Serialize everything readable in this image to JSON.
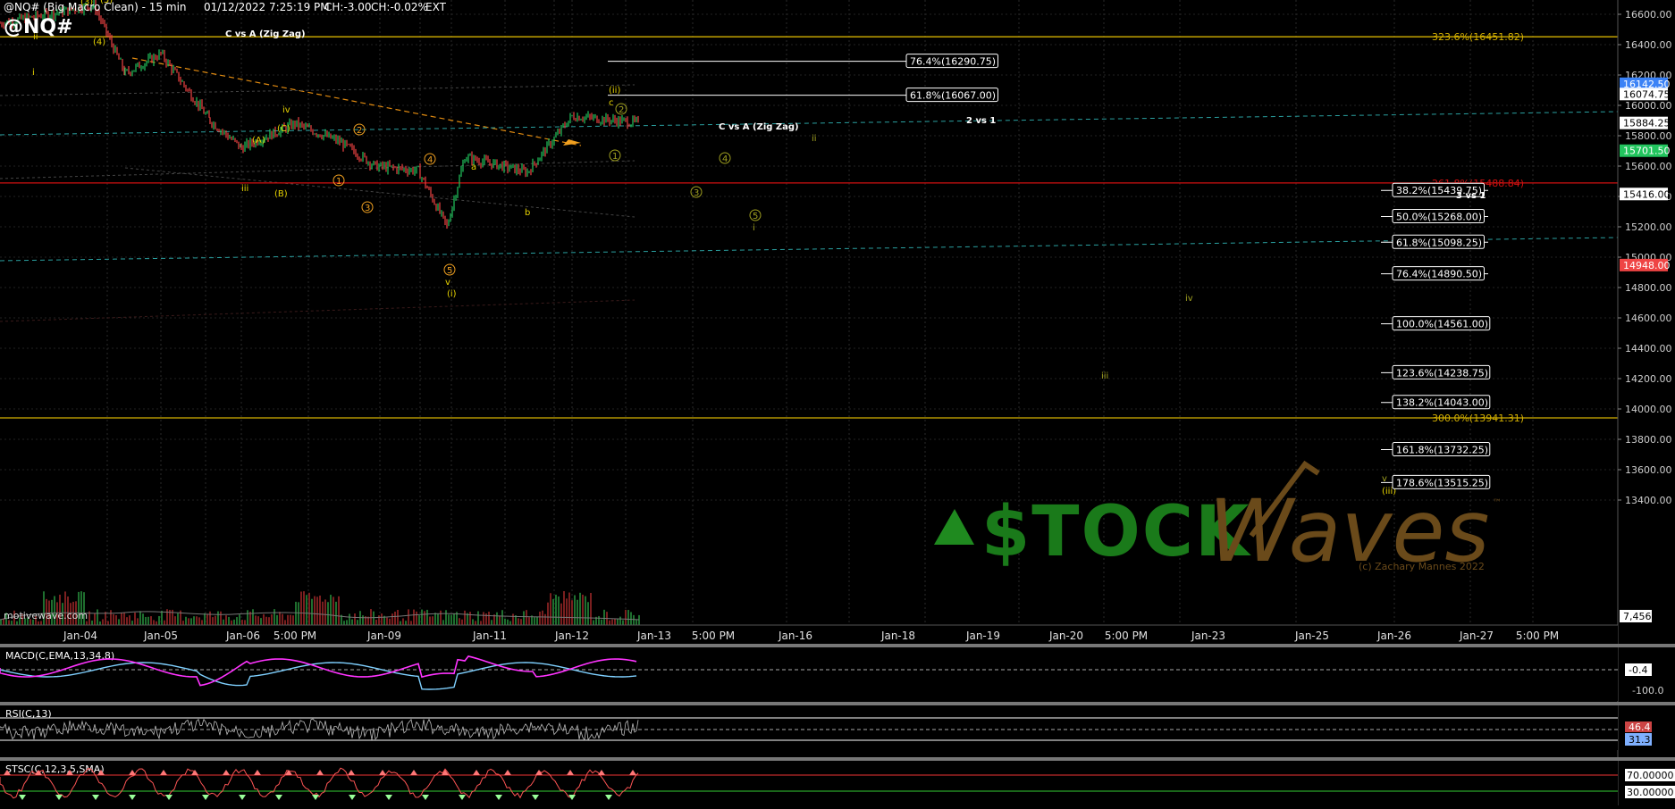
{
  "header": {
    "symbol": "@NQ# (Big Macro Clean) - 15 min",
    "datetime": "01/12/2022 7:25:19 PM",
    "change": "CH:-3.00",
    "change_pct": "CH:-0.02%",
    "session": "EXT",
    "ticker_big": "@NQ#"
  },
  "watermark": {
    "stock_text": "$TOCK",
    "waves_text": "Waves",
    "trademark": "™",
    "copyright": "(c) Zachary Mannes 2022",
    "site": "motivewave.com"
  },
  "colors": {
    "background": "#000000",
    "up_candle": "#22c55e",
    "down_candle": "#ef4444",
    "wave_yellow": "#e6d200",
    "wave_orange": "#f0a020",
    "wave_olive": "#a0a020",
    "fib_line": "#ffffff",
    "extension_red": "#d01010",
    "macd_line": "#ff33ff",
    "macd_signal": "#7fd0ff",
    "rsi_line": "#bbbbbb",
    "stoch_line": "#ff5555"
  },
  "chart_data": {
    "type": "line",
    "title": "@NQ# (Big Macro Clean) - 15 min",
    "ylim": [
      13200,
      16700
    ],
    "y_ticks": [
      13400,
      13600,
      13800,
      14000,
      14200,
      14400,
      14600,
      14800,
      15000,
      15200,
      15400,
      15600,
      15800,
      16000,
      16200,
      16400,
      16600
    ],
    "x_ticks": [
      "Jan-04",
      "Jan-05",
      "Jan-06",
      "5:00 PM",
      "Jan-09",
      "Jan-11",
      "Jan-12",
      "Jan-13",
      "5:00 PM",
      "Jan-16",
      "Jan-18",
      "Jan-19",
      "Jan-20",
      "5:00 PM",
      "Jan-23",
      "Jan-25",
      "Jan-26",
      "Jan-27",
      "5:00 PM"
    ],
    "series": [
      {
        "x": [
          "Jan-03",
          "Jan-04",
          "Jan-04 PM",
          "Jan-05",
          "Jan-05 PM",
          "Jan-06",
          "Jan-06 PM",
          "Jan-07",
          "Jan-09",
          "Jan-10",
          "Jan-10 PM",
          "Jan-11",
          "Jan-11 PM",
          "Jan-12",
          "Jan-12 PM"
        ],
        "values": [
          16540,
          16660,
          16210,
          16340,
          15900,
          15720,
          15880,
          15760,
          15600,
          15570,
          15200,
          15660,
          15560,
          15930,
          15884
        ]
      }
    ],
    "price_labels": [
      {
        "text": "16142.50",
        "value": 16142.5,
        "color": "#3b82f6"
      },
      {
        "text": "16074.75",
        "value": 16074.75,
        "color": "#ffffff"
      },
      {
        "text": "15884.25",
        "value": 15884.25,
        "color": "#ffffff"
      },
      {
        "text": "15701.50",
        "value": 15701.5,
        "color": "#22c55e"
      },
      {
        "text": "15416.00",
        "value": 15416,
        "color": "#ffffff"
      },
      {
        "text": "14948.00",
        "value": 14948,
        "color": "#ef4444"
      }
    ],
    "horizontal_lines": [
      {
        "label": "323.6%(16451.82)",
        "value": 16451.82,
        "color": "#d4b000"
      },
      {
        "label": "261.8%(15488.84)",
        "value": 15488.84,
        "color": "#d01010"
      },
      {
        "label": "300.0%(13941.31)",
        "value": 13941.31,
        "color": "#d4b000"
      }
    ],
    "fib_boxes_upper": [
      {
        "label": "76.4%(16290.75)",
        "value": 16290.75
      },
      {
        "label": "61.8%(16067.00)",
        "value": 16067.0
      }
    ],
    "fib_boxes_lower": [
      {
        "label": "38.2%(15439.75)",
        "value": 15439.75
      },
      {
        "label": "50.0%(15268.00)",
        "value": 15268.0
      },
      {
        "label": "61.8%(15098.25)",
        "value": 15098.25
      },
      {
        "label": "76.4%(14890.50)",
        "value": 14890.5
      },
      {
        "label": "100.0%(14561.00)",
        "value": 14561.0
      },
      {
        "label": "123.6%(14238.75)",
        "value": 14238.75
      },
      {
        "label": "138.2%(14043.00)",
        "value": 14043.0
      },
      {
        "label": "161.8%(13732.25)",
        "value": 13732.25
      },
      {
        "label": "178.6%(13515.25)",
        "value": 13515.25
      }
    ],
    "annotations": [
      "C vs A (Zig Zag)",
      "C vs A (Zig Zag)",
      "2 vs 1",
      "3 vs 1"
    ],
    "wave_labels": [
      "(3)",
      "(5)",
      "(4)",
      "i",
      "ii",
      "(A)",
      "(B)",
      "(C)",
      "iii",
      "iv",
      "v",
      "1",
      "2",
      "3",
      "4",
      "5",
      "a",
      "b",
      "c",
      "(i)",
      "(ii)",
      "(iii)"
    ],
    "volume_last": "7,456"
  },
  "indicators": {
    "macd": {
      "title": "MACD(C,EMA,13,34,8)",
      "labels": [
        "-0.4",
        "-100.0"
      ]
    },
    "rsi": {
      "title": "RSI(C,13)",
      "labels": [
        "46.4",
        "31.3"
      ]
    },
    "stoch": {
      "title": "STSC(C,12,3,5,SMA)",
      "labels": [
        "70.00000",
        "30.00000"
      ]
    }
  }
}
